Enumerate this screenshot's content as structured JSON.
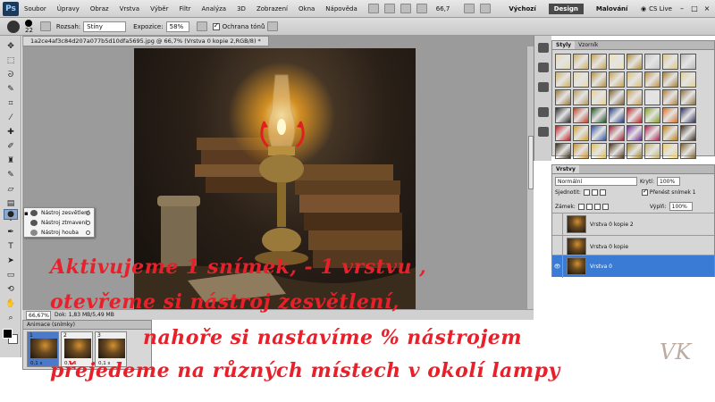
{
  "app": {
    "logo": "Ps",
    "menu": [
      "Soubor",
      "Úpravy",
      "Obraz",
      "Vrstva",
      "Výběr",
      "Filtr",
      "Analýza",
      "3D",
      "Zobrazení",
      "Okna",
      "Nápověda"
    ],
    "zoom": "66,7",
    "workspaces": [
      "Výchozí",
      "Design",
      "Malování"
    ],
    "active_workspace": "Design",
    "cs_live": "CS Live",
    "window_buttons": [
      "–",
      "□",
      "×"
    ]
  },
  "options": {
    "brush_size": "22",
    "range_label": "Rozsah:",
    "range_value": "Stíny",
    "exposure_label": "Expozice:",
    "exposure_value": "58%",
    "protect_label": "Ochrana tónů",
    "protect_checked": true
  },
  "flyout": {
    "items": [
      {
        "label": "Nástroj zesvětlení",
        "key": "O",
        "active": true
      },
      {
        "label": "Nástroj ztmavení",
        "key": "O",
        "active": false
      },
      {
        "label": "Nástroj houba",
        "key": "O",
        "active": false
      }
    ]
  },
  "document": {
    "tab_title": "1a2ce4af3c84d207a077b5d10dfa5695.jpg @ 66,7% (Vrstva 0 kopie 2,RGB/8) *",
    "status_zoom": "66,67%",
    "status_doc": "Dok: 1,83 MB/5,49 MB"
  },
  "animation": {
    "tab": "Animace (snímky)",
    "frames": [
      {
        "num": "1",
        "time": "0,1 s"
      },
      {
        "num": "2",
        "time": "0,1 s"
      },
      {
        "num": "3",
        "time": "0,1 s"
      }
    ],
    "selected_frame": 0
  },
  "styles_panel": {
    "tabs": [
      "Styly",
      "Vzorník"
    ],
    "swatch_colors": [
      "#e8d7a8",
      "#d0b060",
      "#c8a24a",
      "#f0e2b0",
      "#b8903a",
      "#c8c8c8",
      "#e0c880",
      "#b9b9b9",
      "#d0b060",
      "#e8d7a8",
      "#b8903a",
      "#c8a24a",
      "#d8c070",
      "#c09040",
      "#a88030",
      "#e0d090",
      "#9a7a3a",
      "#b89a5a",
      "#e8d090",
      "#806030",
      "#c8a050",
      "#e0e0e0",
      "#b08040",
      "#907040",
      "#2a2a2a",
      "#c04020",
      "#205020",
      "#203a80",
      "#c02020",
      "#80a020",
      "#e07020",
      "#303060",
      "#c02020",
      "#d0a030",
      "#3050a0",
      "#a02030",
      "#702090",
      "#b02050",
      "#c08010",
      "#403020",
      "#3a2a10",
      "#d09020",
      "#e0c050",
      "#503010",
      "#a08020",
      "#c0b060",
      "#f0d060",
      "#806020"
    ]
  },
  "layers_panel": {
    "tab": "Vrstvy",
    "blend_mode": "Normální",
    "opacity_label": "Krytí:",
    "opacity_value": "100%",
    "unify_label": "Sjednotit:",
    "propagate_label": "Přenést snímek 1",
    "lock_label": "Zámek:",
    "fill_label": "Výplň:",
    "fill_value": "100%",
    "layers": [
      {
        "name": "Vrstva 0 kopie 2",
        "selected": false,
        "visible": false
      },
      {
        "name": "Vrstva 0 kopie",
        "selected": false,
        "visible": false
      },
      {
        "name": "Vrstva 0",
        "selected": true,
        "visible": true
      }
    ]
  },
  "tutorial": {
    "line1": "Aktivujeme 1 snímek, - 1 vrstvu ,",
    "line2": "otevřeme si nástroj zesvětlení,",
    "line3": "nahoře si nastavíme %  nástrojem",
    "line4": "přejedeme na různých místech v okolí lampy",
    "color": "#e8202a"
  },
  "signature": "VK"
}
